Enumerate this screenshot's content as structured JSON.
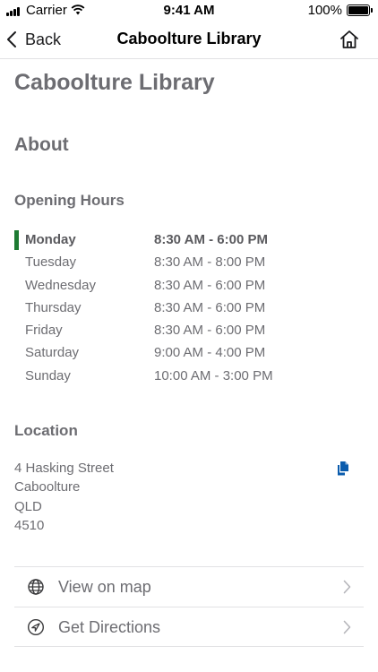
{
  "status_bar": {
    "carrier": "Carrier",
    "time": "9:41 AM",
    "battery_percent": "100%",
    "battery_level": 1.0,
    "icons": [
      "signal-icon",
      "wifi-icon",
      "battery-icon"
    ]
  },
  "nav": {
    "back_label": "Back",
    "title": "Caboolture Library",
    "icons": [
      "chevron-left-icon",
      "home-icon"
    ]
  },
  "page": {
    "title": "Caboolture Library"
  },
  "about": {
    "heading": "About"
  },
  "opening_hours": {
    "heading": "Opening Hours",
    "rows": [
      {
        "day": "Monday",
        "hours": "8:30 AM - 6:00 PM"
      },
      {
        "day": "Tuesday",
        "hours": "8:30 AM - 8:00 PM"
      },
      {
        "day": "Wednesday",
        "hours": "8:30 AM - 6:00 PM"
      },
      {
        "day": "Thursday",
        "hours": "8:30 AM - 6:00 PM"
      },
      {
        "day": "Friday",
        "hours": "8:30 AM - 6:00 PM"
      },
      {
        "day": "Saturday",
        "hours": "9:00 AM - 4:00 PM"
      },
      {
        "day": "Sunday",
        "hours": "10:00 AM - 3:00 PM"
      }
    ],
    "current_day_index": 0,
    "highlight_color": "#1d7a32"
  },
  "location": {
    "heading": "Location",
    "address_lines": [
      "4 Hasking Street",
      "Caboolture",
      "QLD",
      "4510"
    ],
    "copy_icon": "copy-icon",
    "copy_icon_color": "#0b5cad"
  },
  "actions": [
    {
      "label": "View on map",
      "icon": "globe-icon"
    },
    {
      "label": "Get Directions",
      "icon": "navigation-arrow-icon"
    }
  ]
}
